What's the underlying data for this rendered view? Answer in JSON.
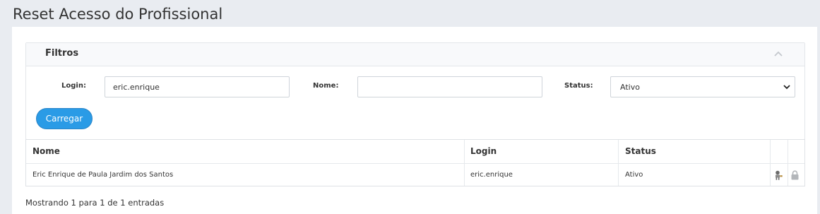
{
  "page": {
    "title": "Reset Acesso do Profissional"
  },
  "filters": {
    "title": "Filtros",
    "login_label": "Login:",
    "login_value": "eric.enrique",
    "nome_label": "Nome:",
    "nome_value": "",
    "status_label": "Status:",
    "status_value": "Ativo",
    "submit_label": "Carregar"
  },
  "table": {
    "columns": [
      "Nome",
      "Login",
      "Status"
    ],
    "rows": [
      {
        "nome": "Eric Enrique de Paula Jardim dos Santos",
        "login": "eric.enrique",
        "status": "Ativo",
        "actions": [
          "user-icon",
          "lock-icon"
        ]
      }
    ]
  },
  "pagination": {
    "info": "Mostrando 1 para 1 de 1 entradas"
  },
  "colors": {
    "primary": "#2a9be6",
    "background": "#e9ecf1",
    "panel_border": "#e3e6ea"
  }
}
